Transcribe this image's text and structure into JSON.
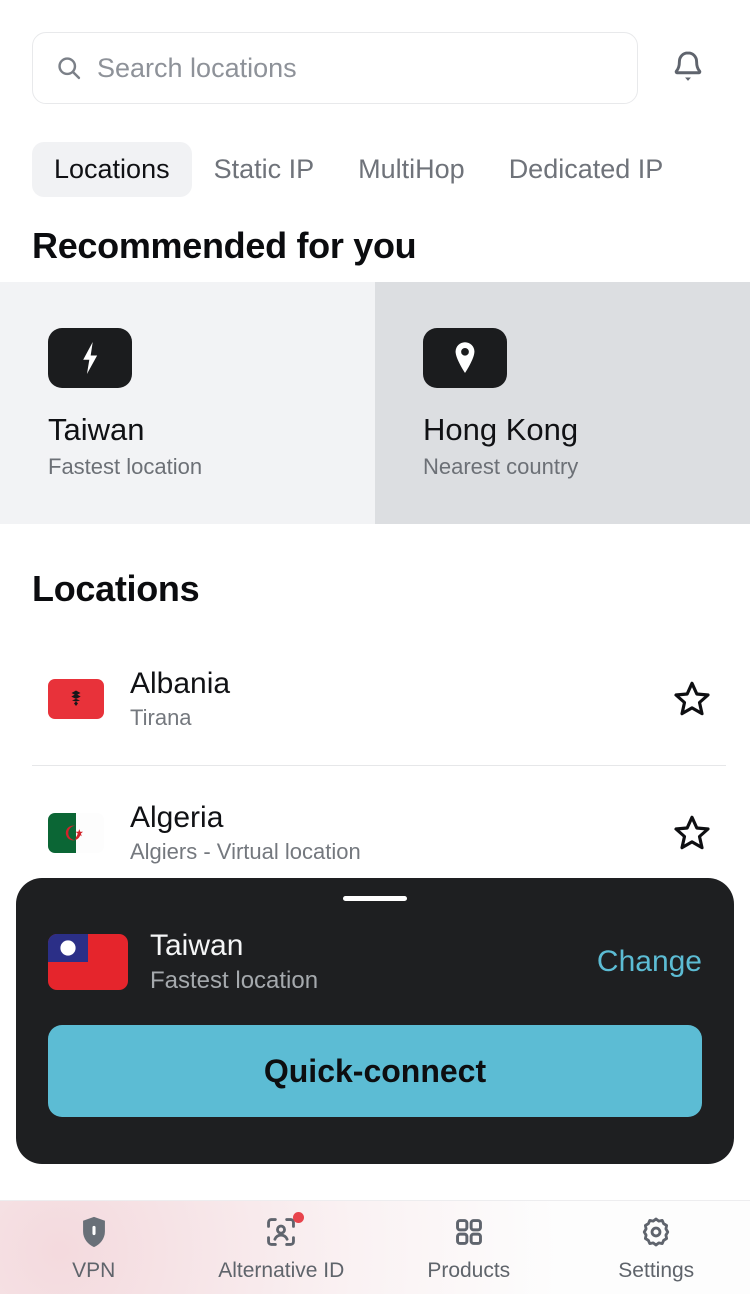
{
  "search": {
    "placeholder": "Search locations",
    "value": "",
    "icon": "search-icon",
    "notification_icon": "bell-icon"
  },
  "tabs": [
    {
      "label": "Locations",
      "active": true
    },
    {
      "label": "Static IP",
      "active": false
    },
    {
      "label": "MultiHop",
      "active": false
    },
    {
      "label": "Dedicated IP",
      "active": false
    }
  ],
  "recommended": {
    "title": "Recommended for you",
    "cards": [
      {
        "name": "Taiwan",
        "subtitle": "Fastest location",
        "icon": "lightning-bolt-icon",
        "bg": "#F2F3F5"
      },
      {
        "name": "Hong Kong",
        "subtitle": "Nearest country",
        "icon": "map-pin-icon",
        "bg": "#DCDEE1"
      }
    ]
  },
  "locations": {
    "title": "Locations",
    "rows": [
      {
        "country": "Albania",
        "city": "Tirana",
        "flag": "albania-flag",
        "favorite_icon": "star-outline-icon",
        "favorited": false
      },
      {
        "country": "Algeria",
        "city": "Algiers - Virtual location",
        "flag": "algeria-flag",
        "favorite_icon": "star-outline-icon",
        "favorited": false
      }
    ]
  },
  "sheet": {
    "handle": "drag-handle",
    "country": "Taiwan",
    "subtitle": "Fastest location",
    "flag": "taiwan-flag",
    "change_label": "Change",
    "connect_label": "Quick-connect",
    "accent_color": "#5CBCD4",
    "background_color": "#1E1F21"
  },
  "bottom_nav": [
    {
      "label": "VPN",
      "icon": "shield-icon",
      "active": true,
      "badge": false
    },
    {
      "label": "Alternative ID",
      "icon": "identity-scan-icon",
      "active": false,
      "badge": true
    },
    {
      "label": "Products",
      "icon": "grid-squares-icon",
      "active": false,
      "badge": false
    },
    {
      "label": "Settings",
      "icon": "gear-icon",
      "active": false,
      "badge": false
    }
  ]
}
